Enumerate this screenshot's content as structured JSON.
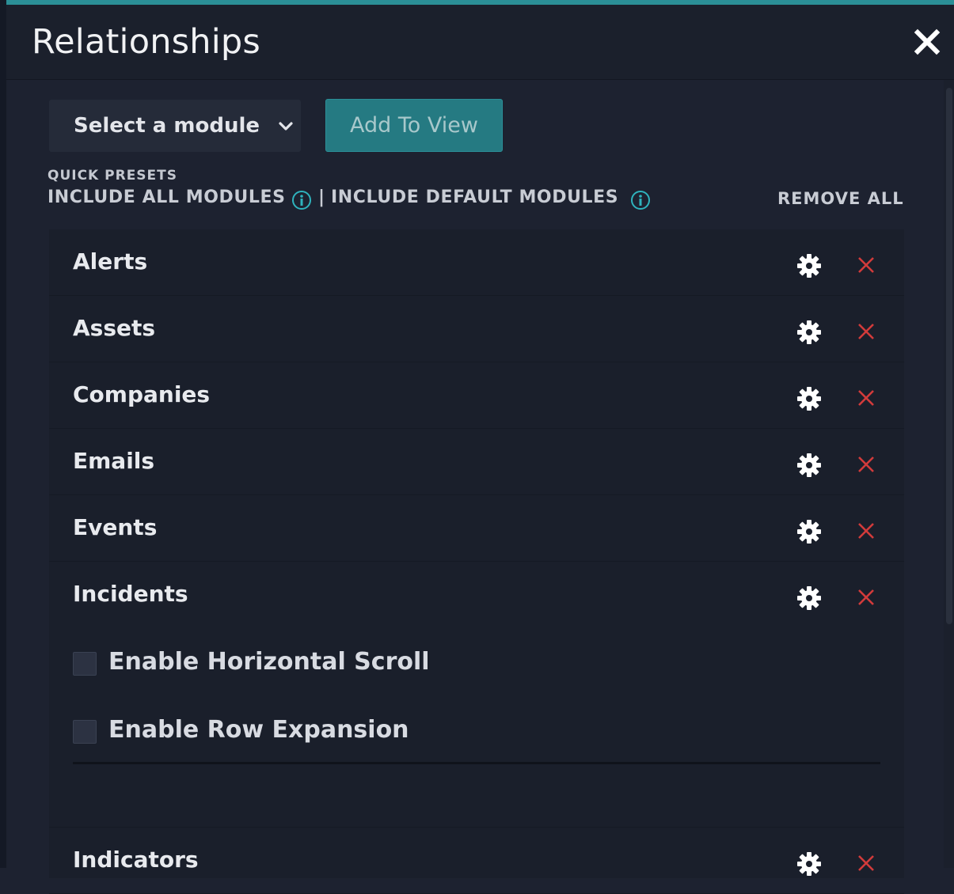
{
  "dialog": {
    "title": "Relationships",
    "close_icon": "close-icon",
    "accent_color": "#2b8f97",
    "background_color": "#1d2230"
  },
  "toolbar": {
    "module_select": {
      "value": "Select a module",
      "icon": "chevron-down-icon"
    },
    "add_button_label": "Add To View"
  },
  "presets": {
    "label": "QUICK PRESETS",
    "include_all": "INCLUDE ALL MODULES",
    "separator": "|",
    "include_default": "INCLUDE DEFAULT MODULES",
    "info_icon": "info-icon",
    "remove_all": "REMOVE ALL"
  },
  "modules": [
    {
      "label": "Alerts",
      "settings_icon": "gear-icon",
      "remove_icon": "close-icon",
      "remove_color": "#d23b3b"
    },
    {
      "label": "Assets",
      "settings_icon": "gear-icon",
      "remove_icon": "close-icon",
      "remove_color": "#d23b3b"
    },
    {
      "label": "Companies",
      "settings_icon": "gear-icon",
      "remove_icon": "close-icon",
      "remove_color": "#d23b3b"
    },
    {
      "label": "Emails",
      "settings_icon": "gear-icon",
      "remove_icon": "close-icon",
      "remove_color": "#d23b3b"
    },
    {
      "label": "Events",
      "settings_icon": "gear-icon",
      "remove_icon": "close-icon",
      "remove_color": "#d23b3b"
    },
    {
      "label": "Incidents",
      "settings_icon": "gear-icon",
      "remove_icon": "close-icon",
      "remove_color": "#d23b3b",
      "options": [
        {
          "label": "Enable Horizontal Scroll",
          "checked": false
        },
        {
          "label": "Enable Row Expansion",
          "checked": false
        }
      ]
    },
    {
      "label": "Indicators",
      "settings_icon": "gear-icon",
      "remove_icon": "close-icon",
      "remove_color": "#d23b3b"
    }
  ]
}
